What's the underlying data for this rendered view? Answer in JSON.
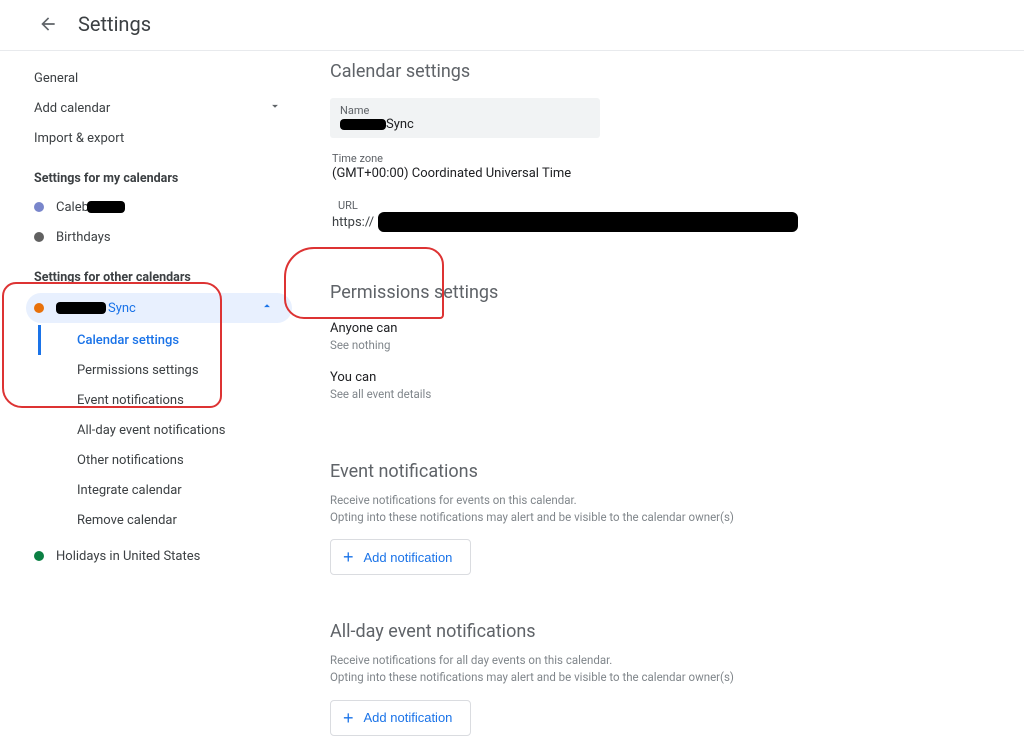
{
  "header": {
    "title": "Settings"
  },
  "sidebar": {
    "general": "General",
    "add_calendar": "Add calendar",
    "import_export": "Import & export",
    "my_cal_heading": "Settings for my calendars",
    "my_cals": [
      {
        "label": "Caleb"
      },
      {
        "label": "Birthdays"
      }
    ],
    "other_cal_heading": "Settings for other calendars",
    "selected_cal": {
      "label": "Sync"
    },
    "sub_items": [
      "Calendar settings",
      "Permissions settings",
      "Event notifications",
      "All-day event notifications",
      "Other notifications",
      "Integrate calendar",
      "Remove calendar"
    ],
    "holidays": "Holidays in United States"
  },
  "main": {
    "calendar_settings": {
      "title": "Calendar settings",
      "name_label": "Name",
      "name_value_suffix": "Sync",
      "tz_label": "Time zone",
      "tz_value": "(GMT+00:00) Coordinated Universal Time",
      "url_label": "URL",
      "url_prefix": "https://"
    },
    "permissions": {
      "title": "Permissions settings",
      "rows": [
        {
          "who": "Anyone can",
          "what": "See nothing"
        },
        {
          "who": "You can",
          "what": "See all event details"
        }
      ]
    },
    "event_notifs": {
      "title": "Event notifications",
      "desc1": "Receive notifications for events on this calendar.",
      "desc2": "Opting into these notifications may alert and be visible to the calendar owner(s)",
      "add_btn": "Add notification"
    },
    "allday_notifs": {
      "title": "All-day event notifications",
      "desc1": "Receive notifications for all day events on this calendar.",
      "desc2": "Opting into these notifications may alert and be visible to the calendar owner(s)",
      "add_btn": "Add notification"
    }
  }
}
